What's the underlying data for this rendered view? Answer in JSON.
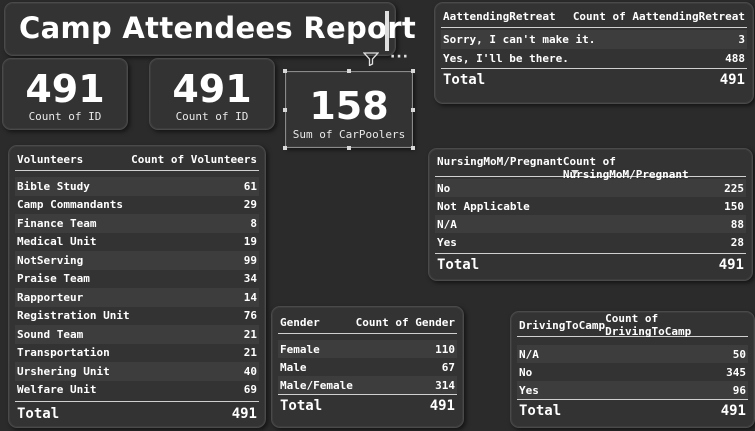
{
  "report": {
    "title": "Camp Attendees Report"
  },
  "kpis": [
    {
      "value": "491",
      "caption": "Count of ID"
    },
    {
      "value": "491",
      "caption": "Count of ID"
    },
    {
      "value": "158",
      "caption": "Sum of CarPoolers"
    }
  ],
  "visual_header": {
    "filter_icon": "filter-icon",
    "more_icon": "more-options-icon",
    "more_glyph": "···"
  },
  "volunteers": {
    "headers": [
      "Volunteers",
      "Count of Volunteers"
    ],
    "rows": [
      [
        "Bible Study",
        "61"
      ],
      [
        "Camp Commandants",
        "29"
      ],
      [
        "Finance Team",
        "8"
      ],
      [
        "Medical Unit",
        "19"
      ],
      [
        "NotServing",
        "99"
      ],
      [
        "Praise Team",
        "34"
      ],
      [
        "Rapporteur",
        "14"
      ],
      [
        "Registration Unit",
        "76"
      ],
      [
        "Sound Team",
        "21"
      ],
      [
        "Transportation",
        "21"
      ],
      [
        "Urshering Unit",
        "40"
      ],
      [
        "Welfare Unit",
        "69"
      ]
    ],
    "total": [
      "Total",
      "491"
    ]
  },
  "retreat": {
    "headers": [
      "AattendingRetreat",
      "Count of AattendingRetreat"
    ],
    "rows": [
      [
        "Sorry, I can't make it.",
        "3"
      ],
      [
        "Yes, I'll be there.",
        "488"
      ]
    ],
    "total": [
      "Total",
      "491"
    ]
  },
  "nursing": {
    "headers": [
      "NursingMoM/Pregnant",
      "Count of NursingMoM/Pregnant"
    ],
    "rows": [
      [
        "No",
        "225"
      ],
      [
        "Not Applicable",
        "150"
      ],
      [
        "N/A",
        "88"
      ],
      [
        "Yes",
        "28"
      ]
    ],
    "total": [
      "Total",
      "491"
    ]
  },
  "gender": {
    "headers": [
      "Gender",
      "Count of Gender"
    ],
    "rows": [
      [
        "Female",
        "110"
      ],
      [
        "Male",
        "67"
      ],
      [
        "Male/Female",
        "314"
      ]
    ],
    "total": [
      "Total",
      "491"
    ]
  },
  "driving": {
    "headers": [
      "DrivingToCamp",
      "Count of DrivingToCamp"
    ],
    "rows": [
      [
        "N/A",
        "50"
      ],
      [
        "No",
        "345"
      ],
      [
        "Yes",
        "96"
      ]
    ],
    "total": [
      "Total",
      "491"
    ]
  }
}
